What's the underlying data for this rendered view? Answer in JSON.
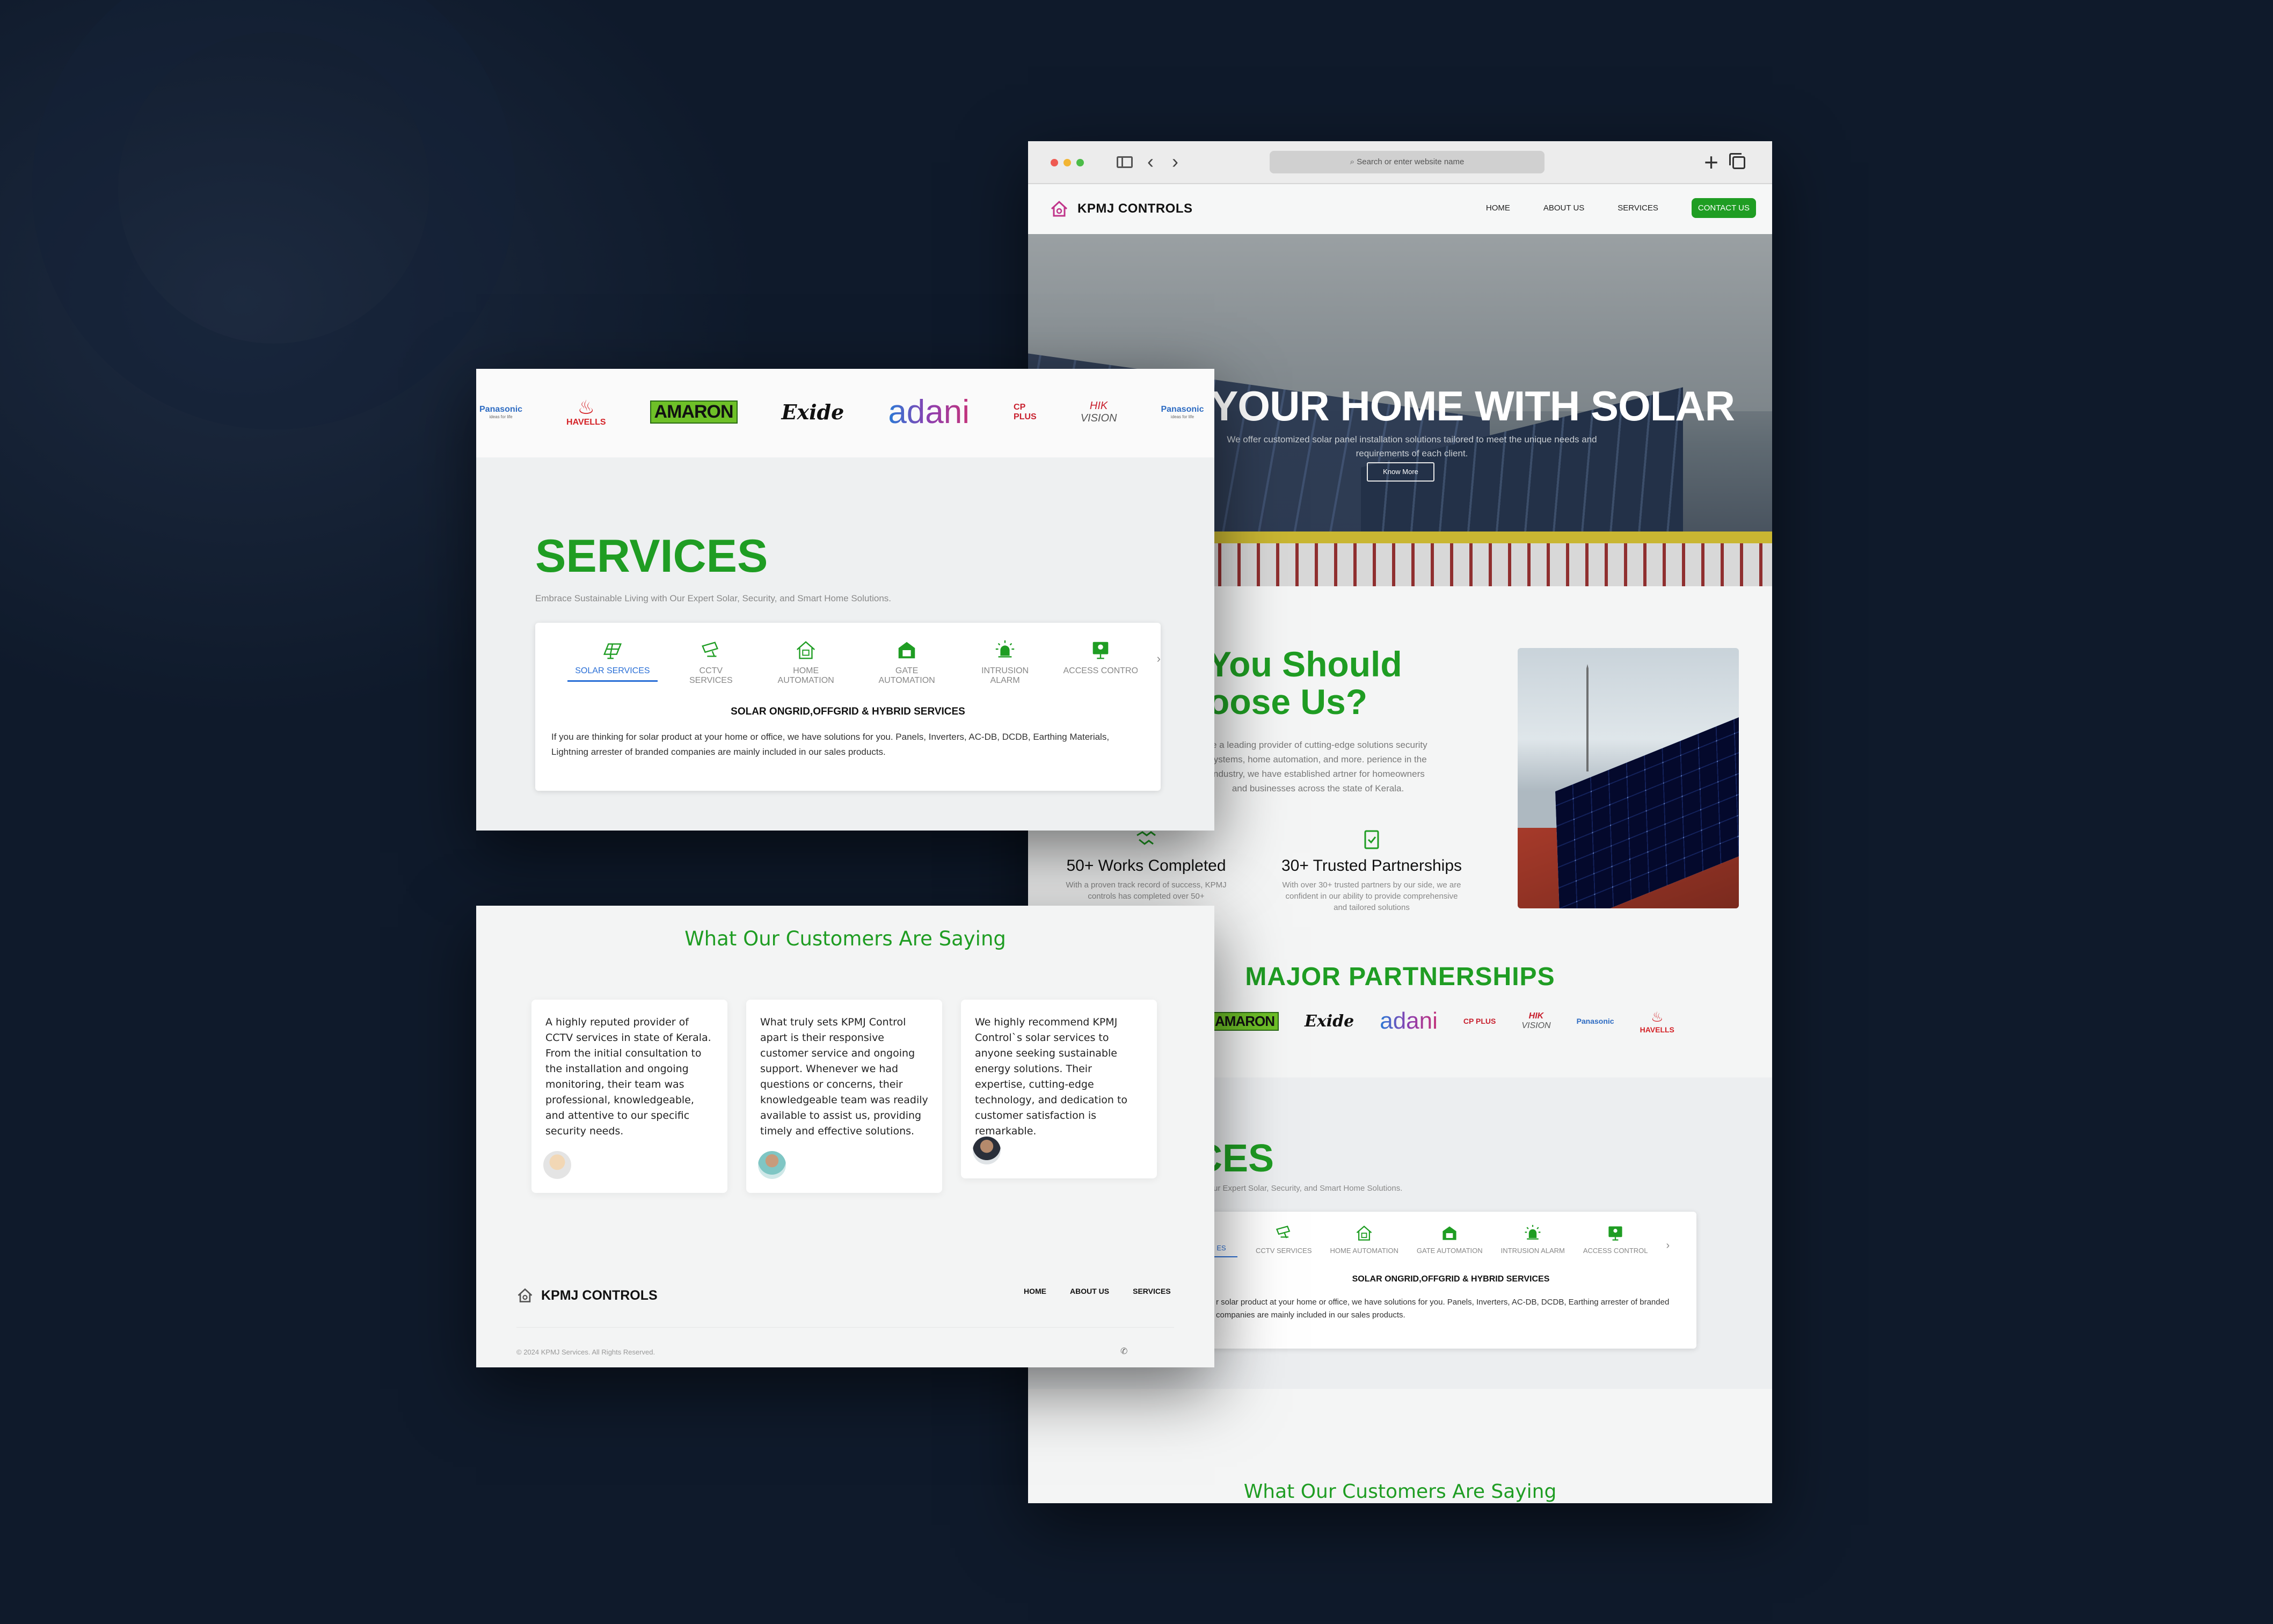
{
  "browser": {
    "url_placeholder": "Search or enter website name"
  },
  "site": {
    "brand": "KPMJ CONTROLS",
    "nav": [
      "HOME",
      "ABOUT US",
      "SERVICES"
    ],
    "cta": "CONTACT US"
  },
  "hero": {
    "title": "ER YOUR HOME WITH SOLAR",
    "subtitle": "We offer customized solar panel installation solutions tailored to meet the unique needs and requirements of each client.",
    "button": "Know More"
  },
  "why": {
    "heading_line1": "You Should",
    "heading_line2": "oose Us?",
    "description": "re a leading provider of cutting-edge solutions security systems, home automation, and more. perience in the industry, we have established artner for homeowners and businesses across the state of Kerala.",
    "stats": [
      {
        "title": "50+ Works Completed",
        "text": "With a proven track record of success, KPMJ controls has completed over 50+"
      },
      {
        "title": "30+ Trusted Partnerships",
        "text": "With over 30+ trusted partners by our side, we are confident in our ability to provide comprehensive and tailored solutions"
      }
    ]
  },
  "partners": {
    "title": "MAJOR PARTNERSHIPS"
  },
  "brands": {
    "panasonic": "Panasonic",
    "panasonic_tag": "ideas for life",
    "havells": "HAVELLS",
    "amaron": "AMARON",
    "exide": "Exide",
    "adani": "adani",
    "cpplus": "CP PLUS",
    "hik_a": "HIK",
    "hik_b": "VISION"
  },
  "services": {
    "title": "SERVICES",
    "title_partial": "ICES",
    "tagline": "Embrace Sustainable Living with Our Expert Solar, Security, and Smart Home Solutions.",
    "tagline_partial": "g with Our Expert Solar, Security, and Smart Home Solutions.",
    "tabs": [
      "SOLAR SERVICES",
      "CCTV SERVICES",
      "HOME AUTOMATION",
      "GATE AUTOMATION",
      "INTRUSION ALARM",
      "ACCESS CONTROL"
    ],
    "tab_partial_first": "ES",
    "tab_partial_last": "ACCESS CONTROL",
    "active_heading": "SOLAR ONGRID,OFFGRID & HYBRID SERVICES",
    "active_body": "If you are thinking for solar product at your home or office, we have solutions for you. Panels, Inverters, AC-DB, DCDB, Earthing Materials, Lightning arrester of branded companies are mainly included in our sales products.",
    "active_body_partial": "r solar product at your home or office, we have solutions for you. Panels, Inverters, AC-DB, DCDB, Earthing arrester of branded companies are mainly included in our sales products."
  },
  "testimonials": {
    "title": "What Our Customers Are Saying",
    "items": [
      {
        "text": "A highly reputed provider of CCTV services in state of Kerala. From the initial consultation to the installation and ongoing monitoring, their team was professional, knowledgeable, and attentive to our specific security needs."
      },
      {
        "text": "What truly sets KPMJ Control apart is their responsive customer service and ongoing support. Whenever we had questions or concerns, their knowledgeable team was readily available to assist us, providing timely and effective solutions."
      },
      {
        "text": "We highly recommend KPMJ Control`s solar services to anyone seeking sustainable energy solutions. Their expertise, cutting-edge technology, and dedication to customer satisfaction is remarkable."
      }
    ]
  },
  "footer": {
    "brand": "KPMJ CONTROLS",
    "menu": [
      "HOME",
      "ABOUT US",
      "SERVICES"
    ],
    "copyright": "© 2024 KPMJ Services. All Rights Reserved."
  },
  "colors": {
    "background": "#0f1a2b",
    "brand_green": "#1f9d23",
    "active_tab_blue": "#2a6fd6"
  }
}
